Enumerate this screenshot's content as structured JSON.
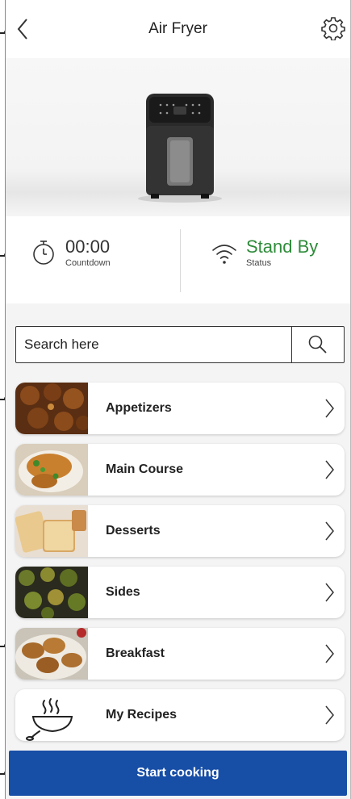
{
  "header": {
    "title": "Air Fryer"
  },
  "stats": {
    "countdown": {
      "value": "00:00",
      "label": "Countdown"
    },
    "status": {
      "value": "Stand By",
      "label": "Status"
    }
  },
  "search": {
    "placeholder": "Search here"
  },
  "categories": [
    {
      "label": "Appetizers"
    },
    {
      "label": "Main Course"
    },
    {
      "label": "Desserts"
    },
    {
      "label": "Sides"
    },
    {
      "label": "Breakfast"
    },
    {
      "label": "My Recipes"
    }
  ],
  "start_button": {
    "label": "Start cooking"
  },
  "colors": {
    "primary": "#174ea6",
    "status_green": "#2e8b3a"
  }
}
